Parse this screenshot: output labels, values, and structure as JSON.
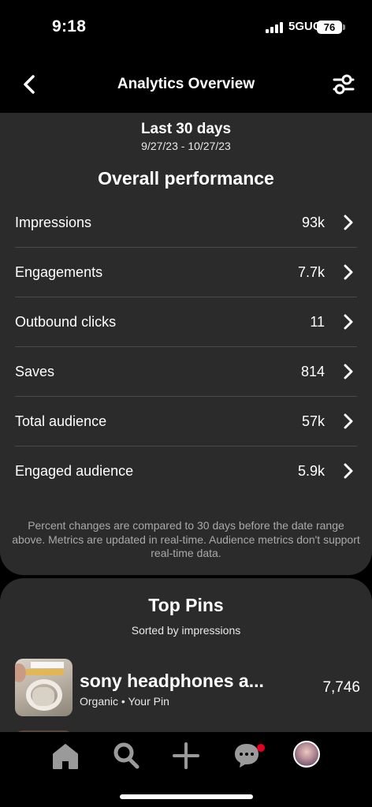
{
  "status_bar": {
    "time": "9:18",
    "network": "5GUC",
    "battery": "76"
  },
  "header": {
    "title": "Analytics Overview",
    "back_icon": "chevron-left-icon",
    "filter_icon": "sliders-icon"
  },
  "date": {
    "label": "Last 30 days",
    "range": "9/27/23 - 10/27/23"
  },
  "performance": {
    "title": "Overall performance",
    "metrics": [
      {
        "label": "Impressions",
        "value": "93k"
      },
      {
        "label": "Engagements",
        "value": "7.7k"
      },
      {
        "label": "Outbound clicks",
        "value": "11"
      },
      {
        "label": "Saves",
        "value": "814"
      },
      {
        "label": "Total audience",
        "value": "57k"
      },
      {
        "label": "Engaged audience",
        "value": "5.9k"
      }
    ],
    "footnote": "Percent changes are compared to 30 days before the date range above. Metrics are updated in real-time. Audience metrics don't support real-time data."
  },
  "top_pins": {
    "title": "Top Pins",
    "subtitle": "Sorted by impressions",
    "items": [
      {
        "title": "sony headphones a...",
        "meta": "Organic • Your Pin",
        "value": "7,746"
      }
    ]
  },
  "tab_bar": {
    "tabs": [
      "home-icon",
      "search-icon",
      "plus-icon",
      "messages-icon",
      "profile-avatar"
    ],
    "notification_color": "#e60023"
  },
  "colors": {
    "background": "#000000",
    "card": "#2b2b2b",
    "divider": "#4a4a4a",
    "muted_text": "#a9a9a9"
  }
}
